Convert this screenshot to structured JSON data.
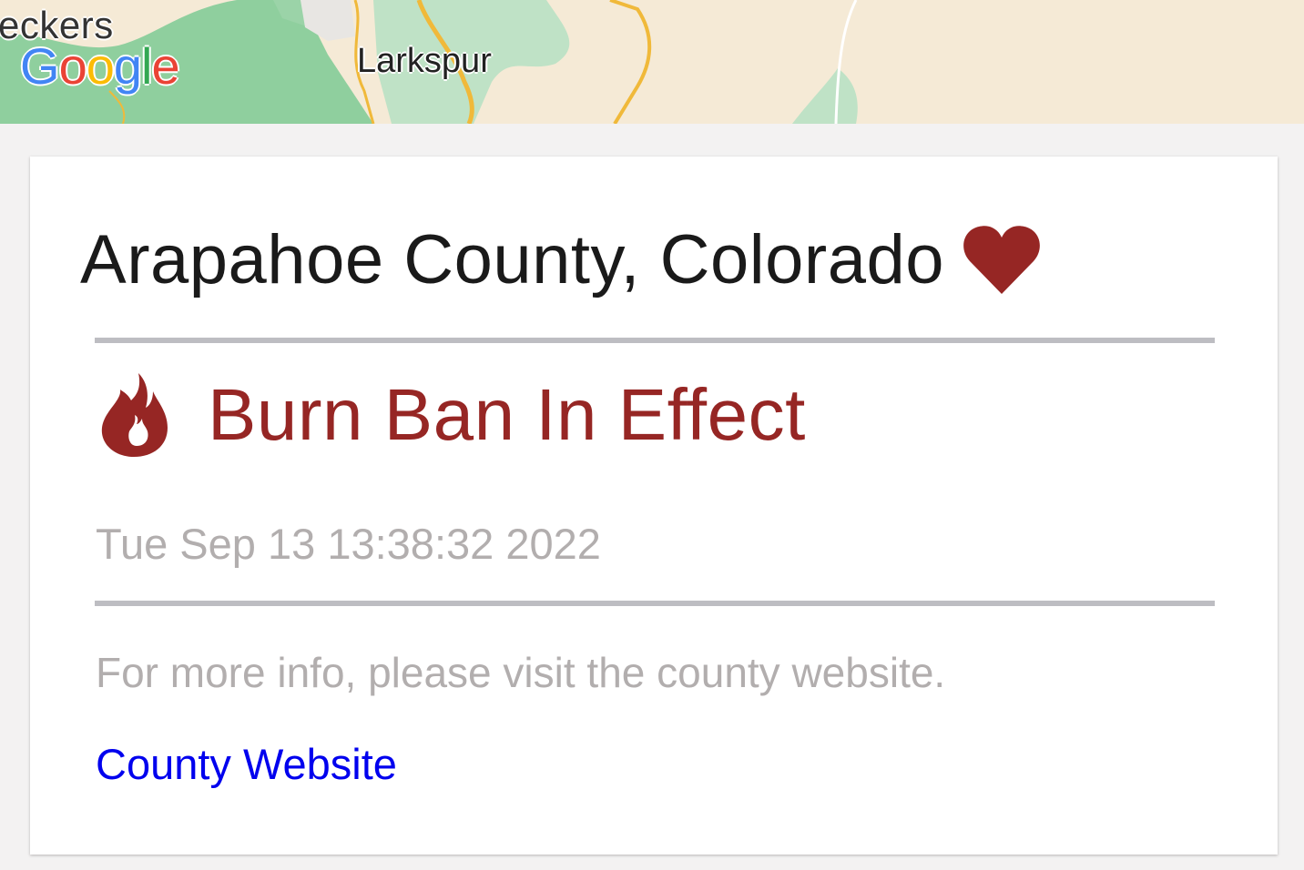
{
  "map": {
    "partial_label": "eckers",
    "place_label": "Larkspur",
    "logo_letters": [
      "G",
      "o",
      "o",
      "g",
      "l",
      "e"
    ]
  },
  "card": {
    "county_title": "Arapahoe County, Colorado",
    "favorite_icon": "heart-icon",
    "status_icon": "fire-icon",
    "status_text": "Burn Ban In Effect",
    "timestamp": "Tue Sep 13 13:38:32 2022",
    "info_text": "For more info, please visit the county website.",
    "link_label": "County Website"
  },
  "colors": {
    "status": "#962624",
    "link": "#0000ee",
    "muted_text": "#b2aeae",
    "divider": "#bdbdc2"
  }
}
